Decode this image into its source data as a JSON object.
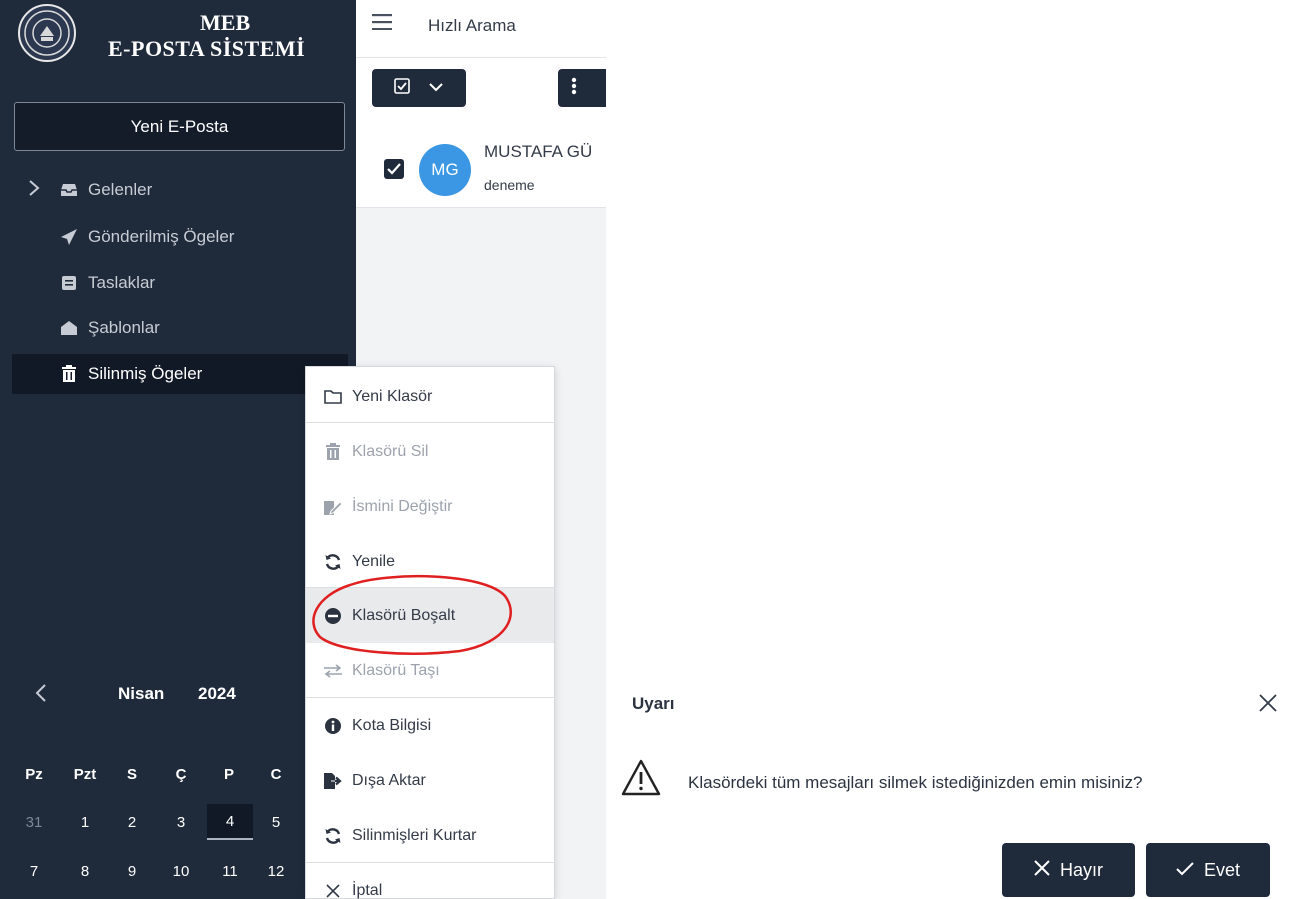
{
  "logo": {
    "line1": "MEB",
    "line2": "E-POSTA SİSTEMİ"
  },
  "sidebar": {
    "new_mail_label": "Yeni E-Posta",
    "items": [
      {
        "label": "Gelenler",
        "icon": "inbox-icon"
      },
      {
        "label": "Gönderilmiş Ögeler",
        "icon": "paper-plane-icon"
      },
      {
        "label": "Taslaklar",
        "icon": "drafts-icon"
      },
      {
        "label": "Şablonlar",
        "icon": "envelope-open-icon"
      },
      {
        "label": "Silinmiş Ögeler",
        "icon": "trash-icon",
        "active": true
      }
    ]
  },
  "calendar": {
    "prev_icon": "chevron-left-icon",
    "month": "Nisan",
    "year": "2024",
    "weekdays": [
      "Pz",
      "Pzt",
      "S",
      "Ç",
      "P",
      "C"
    ],
    "rows": [
      [
        "31",
        "1",
        "2",
        "3",
        "4",
        "5"
      ],
      [
        "7",
        "8",
        "9",
        "10",
        "11",
        "12"
      ]
    ],
    "today": "4"
  },
  "topbar": {
    "search_label": "Hızlı Arama"
  },
  "messages": [
    {
      "avatar": "MG",
      "from": "MUSTAFA GÜ",
      "subject": "deneme",
      "checked": true
    }
  ],
  "context_menu": {
    "items": [
      {
        "label": "Yeni Klasör",
        "icon": "folder-icon",
        "disabled": false
      },
      {
        "label": "Klasörü Sil",
        "icon": "trash-icon",
        "disabled": true
      },
      {
        "label": "İsmini Değiştir",
        "icon": "edit-icon",
        "disabled": true
      },
      {
        "label": "Yenile",
        "icon": "refresh-icon",
        "disabled": false
      },
      {
        "label": "Klasörü Boşalt",
        "icon": "minus-circle-icon",
        "disabled": false,
        "highlighted": true
      },
      {
        "label": "Klasörü Taşı",
        "icon": "exchange-icon",
        "disabled": true
      },
      {
        "label": "Kota Bilgisi",
        "icon": "info-circle-icon",
        "disabled": false
      },
      {
        "label": "Dışa Aktar",
        "icon": "export-icon",
        "disabled": false
      },
      {
        "label": "Silinmişleri Kurtar",
        "icon": "refresh-icon",
        "disabled": false
      },
      {
        "label": "İptal",
        "icon": "close-icon",
        "disabled": false
      }
    ]
  },
  "dialog": {
    "title": "Uyarı",
    "message": "Klasördeki tüm mesajları silmek istediğinizden emin misiniz?",
    "no_label": "Hayır",
    "yes_label": "Evet"
  },
  "colors": {
    "sidebar_bg": "#1f2a3b",
    "sidebar_active": "#111927",
    "avatar": "#3b97e3",
    "annotation": "#e02020"
  }
}
